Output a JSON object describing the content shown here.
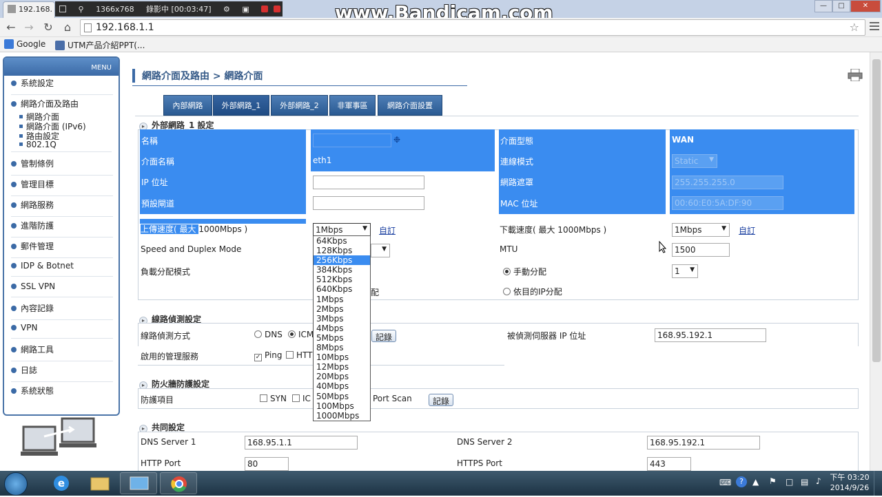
{
  "browser": {
    "tab_title": "192.168.",
    "recorder": {
      "resolution": "1366x768",
      "status": "錄影中 [00:03:47]"
    },
    "watermark": "www.Bandicam.com",
    "url": "192.168.1.1",
    "bookmarks": [
      "Google",
      "UTM产品介紹PPT(..."
    ]
  },
  "sidebar": {
    "menu_label": "MENU",
    "items": [
      "系統設定",
      "網路介面及路由",
      "管制條例",
      "管理目標",
      "網路服務",
      "進階防護",
      "郵件管理",
      "IDP & Botnet",
      "SSL VPN",
      "內容記錄",
      "VPN",
      "網路工具",
      "日誌",
      "系統狀態"
    ],
    "subitems": [
      "網路介面",
      "網路介面 (IPv6)",
      "路由設定",
      "802.1Q"
    ]
  },
  "header": {
    "title": "網路介面及路由 > 網路介面"
  },
  "tabs": [
    "內部網路",
    "外部網路_1",
    "外部網路_2",
    "非軍事區",
    "網路介面設置"
  ],
  "wan_section": {
    "title": "外部網路_1 設定",
    "name_label": "名稱",
    "interface_type_label": "介面型態",
    "interface_type_value": "WAN",
    "interface_name_label": "介面名稱",
    "interface_name_value": "eth1",
    "conn_mode_label": "連線模式",
    "conn_mode_value": "Static",
    "ip_label": "IP 位址",
    "netmask_label": "網路遮罩",
    "netmask_value": "255.255.255.0",
    "gateway_label": "預設閘道",
    "mac_label": "MAC 位址",
    "mac_value": "00:60:E0:5A:DF:90",
    "upload_label_a": "上傳速度( 最大 ",
    "upload_label_b": "1000Mbps )",
    "upload_value": "1Mbps",
    "custom_link": "自訂",
    "download_label": "下載速度( 最大 1000Mbps )",
    "download_value": "1Mbps",
    "speed_duplex_label": "Speed and Duplex Mode",
    "mtu_label": "MTU",
    "mtu_value": "1500",
    "lb_label": "負載分配模式",
    "manual_label": "手動分配",
    "manual_value": "1",
    "dest_ip_label": "依目的IP分配",
    "hidden_fragment": "配"
  },
  "upload_options": [
    "64Kbps",
    "128Kbps",
    "256Kbps",
    "384Kbps",
    "512Kbps",
    "640Kbps",
    "1Mbps",
    "2Mbps",
    "3Mbps",
    "4Mbps",
    "5Mbps",
    "8Mbps",
    "10Mbps",
    "12Mbps",
    "20Mbps",
    "40Mbps",
    "50Mbps",
    "100Mbps",
    "1000Mbps"
  ],
  "upload_highlighted": "256Kbps",
  "line_detect": {
    "title": "線路偵測設定",
    "method_label": "線路偵測方式",
    "dns": "DNS",
    "icmp": "ICM",
    "log_button": "記錄",
    "server_label": "被偵測伺服器 IP 位址",
    "server_value": "168.95.192.1",
    "mgmt_label": "啟用的管理服務",
    "ping": "Ping",
    "http": "HTT"
  },
  "firewall": {
    "title": "防火牆防護設定",
    "items_label": "防護項目",
    "syn": "SYN",
    "icmp": "IC",
    "portscan": "Port Scan",
    "log_button": "記錄"
  },
  "common": {
    "title": "共同設定",
    "dns1_label": "DNS Server 1",
    "dns1_value": "168.95.1.1",
    "dns2_label": "DNS Server 2",
    "dns2_value": "168.95.192.1",
    "http_label": "HTTP Port",
    "http_value": "80",
    "https_label": "HTTPS Port",
    "https_value": "443"
  },
  "taskbar": {
    "clock_time": "下午 03:20",
    "clock_date": "2014/9/26"
  },
  "colors": {
    "accent": "#3a8cf0",
    "tab": "#2a5a92",
    "title": "#355a88"
  }
}
